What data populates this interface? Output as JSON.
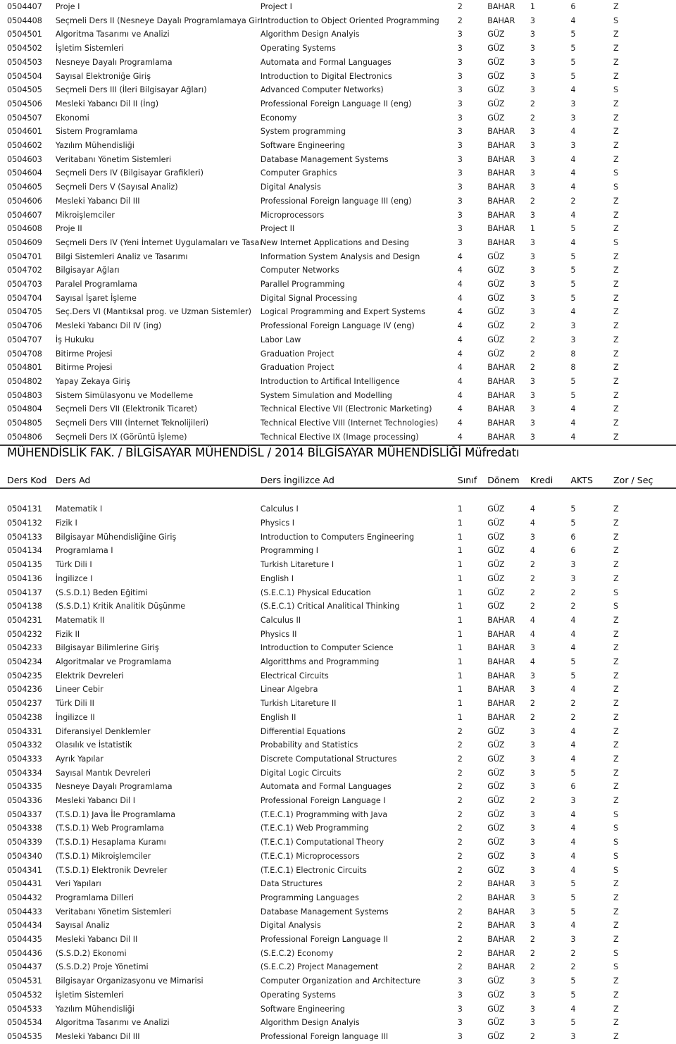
{
  "document": {
    "type": "curriculum-table",
    "columns": [
      "Ders Kod",
      "Ders Ad",
      "Ders İngilizce Ad",
      "Sınıf",
      "Dönem",
      "Kredi",
      "AKTS",
      "Zor / Seç"
    ],
    "section_header": "MÜHENDİSLİK FAK. / BİLGİSAYAR MÜHENDİSL / 2014 BİLGİSAYAR MÜHENDİSLİĞİ Müfredatı"
  },
  "headers": {
    "code": "Ders Kod",
    "name": "Ders Ad",
    "eng_name": "Ders İngilizce Ad",
    "class": "Sınıf",
    "term": "Dönem",
    "credit": "Kredi",
    "akts": "AKTS",
    "type": "Zor / Seç"
  },
  "top_rows": [
    {
      "code": "0504407",
      "name": "Proje I",
      "eng": "Project I",
      "class": "2",
      "term": "BAHAR",
      "credit": "1",
      "akts": "6",
      "type": "Z"
    },
    {
      "code": "0504408",
      "name": "Seçmeli Ders II (Nesneye Dayalı Programlamaya Giri",
      "eng": "Introduction to Object Oriented Programming",
      "class": "2",
      "term": "BAHAR",
      "credit": "3",
      "akts": "4",
      "type": "S"
    },
    {
      "code": "0504501",
      "name": "Algoritma Tasarımı ve Analizi",
      "eng": "Algorithm Design Analyis",
      "class": "3",
      "term": "GÜZ",
      "credit": "3",
      "akts": "5",
      "type": "Z"
    },
    {
      "code": "0504502",
      "name": "İşletim Sistemleri",
      "eng": "Operating Systems",
      "class": "3",
      "term": "GÜZ",
      "credit": "3",
      "akts": "5",
      "type": "Z"
    },
    {
      "code": "0504503",
      "name": "Nesneye Dayalı Programlama",
      "eng": "Automata and Formal Languages",
      "class": "3",
      "term": "GÜZ",
      "credit": "3",
      "akts": "5",
      "type": "Z"
    },
    {
      "code": "0504504",
      "name": "Sayısal Elektroniğe Giriş",
      "eng": "Introduction to Digital Electronics",
      "class": "3",
      "term": "GÜZ",
      "credit": "3",
      "akts": "5",
      "type": "Z"
    },
    {
      "code": "0504505",
      "name": "Seçmeli Ders III (İleri Bilgisayar Ağları)",
      "eng": "Advanced Computer Networks)",
      "class": "3",
      "term": "GÜZ",
      "credit": "3",
      "akts": "4",
      "type": "S"
    },
    {
      "code": "0504506",
      "name": "Mesleki Yabancı Dil II (İng)",
      "eng": "Professional Foreign Language II (eng)",
      "class": "3",
      "term": "GÜZ",
      "credit": "2",
      "akts": "3",
      "type": "Z"
    },
    {
      "code": "0504507",
      "name": "Ekonomi",
      "eng": "Economy",
      "class": "3",
      "term": "GÜZ",
      "credit": "2",
      "akts": "3",
      "type": "Z"
    },
    {
      "code": "0504601",
      "name": "Sistem Programlama",
      "eng": "System programming",
      "class": "3",
      "term": "BAHAR",
      "credit": "3",
      "akts": "4",
      "type": "Z"
    },
    {
      "code": "0504602",
      "name": "Yazılım Mühendisliği",
      "eng": "Software Engineering",
      "class": "3",
      "term": "BAHAR",
      "credit": "3",
      "akts": "3",
      "type": "Z"
    },
    {
      "code": "0504603",
      "name": "Veritabanı Yönetim Sistemleri",
      "eng": "Database Management Systems",
      "class": "3",
      "term": "BAHAR",
      "credit": "3",
      "akts": "4",
      "type": "Z"
    },
    {
      "code": "0504604",
      "name": "Seçmeli Ders IV (Bilgisayar Grafikleri)",
      "eng": "Computer Graphics",
      "class": "3",
      "term": "BAHAR",
      "credit": "3",
      "akts": "4",
      "type": "S"
    },
    {
      "code": "0504605",
      "name": "Seçmeli Ders V (Sayısal Analiz)",
      "eng": "Digital Analysis",
      "class": "3",
      "term": "BAHAR",
      "credit": "3",
      "akts": "4",
      "type": "S"
    },
    {
      "code": "0504606",
      "name": "Mesleki Yabancı Dil III",
      "eng": "Professional Foreign language III (eng)",
      "class": "3",
      "term": "BAHAR",
      "credit": "2",
      "akts": "2",
      "type": "Z"
    },
    {
      "code": "0504607",
      "name": "Mikroişlemciler",
      "eng": "Microprocessors",
      "class": "3",
      "term": "BAHAR",
      "credit": "3",
      "akts": "4",
      "type": "Z"
    },
    {
      "code": "0504608",
      "name": "Proje II",
      "eng": "Project II",
      "class": "3",
      "term": "BAHAR",
      "credit": "1",
      "akts": "5",
      "type": "Z"
    },
    {
      "code": "0504609",
      "name": "Seçmeli Ders IV (Yeni İnternet Uygulamaları ve Tasarım",
      "eng": "New Internet Applications and Desing",
      "class": "3",
      "term": "BAHAR",
      "credit": "3",
      "akts": "4",
      "type": "S"
    },
    {
      "code": "0504701",
      "name": "Bilgi Sistemleri Analiz ve Tasarımı",
      "eng": "Information System Analysis and Design",
      "class": "4",
      "term": "GÜZ",
      "credit": "3",
      "akts": "5",
      "type": "Z"
    },
    {
      "code": "0504702",
      "name": "Bilgisayar Ağları",
      "eng": "Computer Networks",
      "class": "4",
      "term": "GÜZ",
      "credit": "3",
      "akts": "5",
      "type": "Z"
    },
    {
      "code": "0504703",
      "name": "Paralel Programlama",
      "eng": "Parallel Programming",
      "class": "4",
      "term": "GÜZ",
      "credit": "3",
      "akts": "5",
      "type": "Z"
    },
    {
      "code": "0504704",
      "name": "Sayısal İşaret İşleme",
      "eng": "Digital Signal Processing",
      "class": "4",
      "term": "GÜZ",
      "credit": "3",
      "akts": "5",
      "type": "Z"
    },
    {
      "code": "0504705",
      "name": "Seç.Ders VI (Mantıksal prog. ve Uzman Sistemler)",
      "eng": "Logical Programming and Expert Systems",
      "class": "4",
      "term": "GÜZ",
      "credit": "3",
      "akts": "4",
      "type": "Z"
    },
    {
      "code": "0504706",
      "name": "Mesleki Yabancı Dil IV (ing)",
      "eng": "Professional Foreign Language IV (eng)",
      "class": "4",
      "term": "GÜZ",
      "credit": "2",
      "akts": "3",
      "type": "Z"
    },
    {
      "code": "0504707",
      "name": "İş Hukuku",
      "eng": "Labor Law",
      "class": "4",
      "term": "GÜZ",
      "credit": "2",
      "akts": "3",
      "type": "Z"
    },
    {
      "code": "0504708",
      "name": "Bitirme Projesi",
      "eng": "Graduation Project",
      "class": "4",
      "term": "GÜZ",
      "credit": "2",
      "akts": "8",
      "type": "Z"
    },
    {
      "code": "0504801",
      "name": "Bitirme Projesi",
      "eng": "Graduation Project",
      "class": "4",
      "term": "BAHAR",
      "credit": "2",
      "akts": "8",
      "type": "Z"
    },
    {
      "code": "0504802",
      "name": "Yapay Zekaya Giriş",
      "eng": "Introduction to Artifical Intelligence",
      "class": "4",
      "term": "BAHAR",
      "credit": "3",
      "akts": "5",
      "type": "Z"
    },
    {
      "code": "0504803",
      "name": "Sistem Simülasyonu ve Modelleme",
      "eng": "System Simulation and Modelling",
      "class": "4",
      "term": "BAHAR",
      "credit": "3",
      "akts": "5",
      "type": "Z"
    },
    {
      "code": "0504804",
      "name": "Seçmeli Ders VII (Elektronik Ticaret)",
      "eng": "Technical Elective VII (Electronic Marketing)",
      "class": "4",
      "term": "BAHAR",
      "credit": "3",
      "akts": "4",
      "type": "Z"
    },
    {
      "code": "0504805",
      "name": "Seçmeli Ders VIII (İnternet Teknolijileri)",
      "eng": "Technical Elective VIII (Internet Technologies)",
      "class": "4",
      "term": "BAHAR",
      "credit": "3",
      "akts": "4",
      "type": "Z"
    },
    {
      "code": "0504806",
      "name": "Seçmeli Ders IX (Görüntü İşleme)",
      "eng": "Technical Elective IX (Image processing)",
      "class": "4",
      "term": "BAHAR",
      "credit": "3",
      "akts": "4",
      "type": "Z"
    }
  ],
  "bottom_rows": [
    {
      "code": "0504131",
      "name": "Matematik I",
      "eng": "Calculus I",
      "class": "1",
      "term": "GÜZ",
      "credit": "4",
      "akts": "5",
      "type": "Z"
    },
    {
      "code": "0504132",
      "name": "Fizik I",
      "eng": "Physics I",
      "class": "1",
      "term": "GÜZ",
      "credit": "4",
      "akts": "5",
      "type": "Z"
    },
    {
      "code": "0504133",
      "name": "Bilgisayar Mühendisliğine Giriş",
      "eng": "Introduction to Computers Engineering",
      "class": "1",
      "term": "GÜZ",
      "credit": "3",
      "akts": "6",
      "type": "Z"
    },
    {
      "code": "0504134",
      "name": "Programlama I",
      "eng": "Programming I",
      "class": "1",
      "term": "GÜZ",
      "credit": "4",
      "akts": "6",
      "type": "Z"
    },
    {
      "code": "0504135",
      "name": "Türk Dili I",
      "eng": "Turkish Litareture I",
      "class": "1",
      "term": "GÜZ",
      "credit": "2",
      "akts": "3",
      "type": "Z"
    },
    {
      "code": "0504136",
      "name": "İngilizce I",
      "eng": "English I",
      "class": "1",
      "term": "GÜZ",
      "credit": "2",
      "akts": "3",
      "type": "Z"
    },
    {
      "code": "0504137",
      "name": "(S.S.D.1) Beden Eğitimi",
      "eng": "(S.E.C.1) Physical Education",
      "class": "1",
      "term": "GÜZ",
      "credit": "2",
      "akts": "2",
      "type": "S"
    },
    {
      "code": "0504138",
      "name": "(S.S.D.1) Kritik Analitik Düşünme",
      "eng": "(S.E.C.1) Critical Analitical Thinking",
      "class": "1",
      "term": "GÜZ",
      "credit": "2",
      "akts": "2",
      "type": "S"
    },
    {
      "code": "0504231",
      "name": "Matematik II",
      "eng": "Calculus II",
      "class": "1",
      "term": "BAHAR",
      "credit": "4",
      "akts": "4",
      "type": "Z"
    },
    {
      "code": "0504232",
      "name": "Fizik II",
      "eng": "Physics II",
      "class": "1",
      "term": "BAHAR",
      "credit": "4",
      "akts": "4",
      "type": "Z"
    },
    {
      "code": "0504233",
      "name": "Bilgisayar Bilimlerine Giriş",
      "eng": "Introduction to Computer Science",
      "class": "1",
      "term": "BAHAR",
      "credit": "3",
      "akts": "4",
      "type": "Z"
    },
    {
      "code": "0504234",
      "name": "Algoritmalar ve Programlama",
      "eng": "Algoritthms and Programming",
      "class": "1",
      "term": "BAHAR",
      "credit": "4",
      "akts": "5",
      "type": "Z"
    },
    {
      "code": "0504235",
      "name": "Elektrik Devreleri",
      "eng": "Electrical Circuits",
      "class": "1",
      "term": "BAHAR",
      "credit": "3",
      "akts": "5",
      "type": "Z"
    },
    {
      "code": "0504236",
      "name": "Lineer Cebir",
      "eng": "Linear Algebra",
      "class": "1",
      "term": "BAHAR",
      "credit": "3",
      "akts": "4",
      "type": "Z"
    },
    {
      "code": "0504237",
      "name": "Türk Dili II",
      "eng": "Turkish Litareture II",
      "class": "1",
      "term": "BAHAR",
      "credit": "2",
      "akts": "2",
      "type": "Z"
    },
    {
      "code": "0504238",
      "name": "İngilizce II",
      "eng": "English II",
      "class": "1",
      "term": "BAHAR",
      "credit": "2",
      "akts": "2",
      "type": "Z"
    },
    {
      "code": "0504331",
      "name": "Diferansiyel Denklemler",
      "eng": "Differential Equations",
      "class": "2",
      "term": "GÜZ",
      "credit": "3",
      "akts": "4",
      "type": "Z"
    },
    {
      "code": "0504332",
      "name": "Olasılık ve İstatistik",
      "eng": "Probability and Statistics",
      "class": "2",
      "term": "GÜZ",
      "credit": "3",
      "akts": "4",
      "type": "Z"
    },
    {
      "code": "0504333",
      "name": "Ayrık Yapılar",
      "eng": "Discrete Computational Structures",
      "class": "2",
      "term": "GÜZ",
      "credit": "3",
      "akts": "4",
      "type": "Z"
    },
    {
      "code": "0504334",
      "name": "Sayısal Mantık Devreleri",
      "eng": "Digital Logic Circuits",
      "class": "2",
      "term": "GÜZ",
      "credit": "3",
      "akts": "5",
      "type": "Z"
    },
    {
      "code": "0504335",
      "name": "Nesneye Dayalı Programlama",
      "eng": "Automata and Formal Languages",
      "class": "2",
      "term": "GÜZ",
      "credit": "3",
      "akts": "6",
      "type": "Z"
    },
    {
      "code": "0504336",
      "name": "Mesleki Yabancı Dil I",
      "eng": "Professional Foreign Language I",
      "class": "2",
      "term": "GÜZ",
      "credit": "2",
      "akts": "3",
      "type": "Z"
    },
    {
      "code": "0504337",
      "name": "(T.S.D.1) Java İle Programlama",
      "eng": "(T.E.C.1) Programming with Java",
      "class": "2",
      "term": "GÜZ",
      "credit": "3",
      "akts": "4",
      "type": "S"
    },
    {
      "code": "0504338",
      "name": "(T.S.D.1) Web Programlama",
      "eng": "(T.E.C.1) Web Programming",
      "class": "2",
      "term": "GÜZ",
      "credit": "3",
      "akts": "4",
      "type": "S"
    },
    {
      "code": "0504339",
      "name": "(T.S.D.1) Hesaplama Kuramı",
      "eng": "(T.E.C.1) Computational Theory",
      "class": "2",
      "term": "GÜZ",
      "credit": "3",
      "akts": "4",
      "type": "S"
    },
    {
      "code": "0504340",
      "name": "(T.S.D.1) Mikroişlemciler",
      "eng": "(T.E.C.1) Microprocessors",
      "class": "2",
      "term": "GÜZ",
      "credit": "3",
      "akts": "4",
      "type": "S"
    },
    {
      "code": "0504341",
      "name": "(T.S.D.1) Elektronik Devreler",
      "eng": "(T.E.C.1) Electronic Circuits",
      "class": "2",
      "term": "GÜZ",
      "credit": "3",
      "akts": "4",
      "type": "S"
    },
    {
      "code": "0504431",
      "name": "Veri Yapıları",
      "eng": "Data Structures",
      "class": "2",
      "term": "BAHAR",
      "credit": "3",
      "akts": "5",
      "type": "Z"
    },
    {
      "code": "0504432",
      "name": "Programlama Dilleri",
      "eng": "Programming Languages",
      "class": "2",
      "term": "BAHAR",
      "credit": "3",
      "akts": "5",
      "type": "Z"
    },
    {
      "code": "0504433",
      "name": "Veritabanı Yönetim Sistemleri",
      "eng": "Database Management Systems",
      "class": "2",
      "term": "BAHAR",
      "credit": "3",
      "akts": "5",
      "type": "Z"
    },
    {
      "code": "0504434",
      "name": "Sayısal Analiz",
      "eng": "Digital Analysis",
      "class": "2",
      "term": "BAHAR",
      "credit": "3",
      "akts": "4",
      "type": "Z"
    },
    {
      "code": "0504435",
      "name": "Mesleki Yabancı Dil II",
      "eng": "Professional Foreign Language II",
      "class": "2",
      "term": "BAHAR",
      "credit": "2",
      "akts": "3",
      "type": "Z"
    },
    {
      "code": "0504436",
      "name": "(S.S.D.2) Ekonomi",
      "eng": "(S.E.C.2) Economy",
      "class": "2",
      "term": "BAHAR",
      "credit": "2",
      "akts": "2",
      "type": "S"
    },
    {
      "code": "0504437",
      "name": "(S.S.D.2) Proje Yönetimi",
      "eng": "(S.E.C.2) Project Management",
      "class": "2",
      "term": "BAHAR",
      "credit": "2",
      "akts": "2",
      "type": "S"
    },
    {
      "code": "0504531",
      "name": "Bilgisayar Organizasyonu ve Mimarisi",
      "eng": "Computer Organization and Architecture",
      "class": "3",
      "term": "GÜZ",
      "credit": "3",
      "akts": "5",
      "type": "Z"
    },
    {
      "code": "0504532",
      "name": "İşletim Sistemleri",
      "eng": "Operating Systems",
      "class": "3",
      "term": "GÜZ",
      "credit": "3",
      "akts": "5",
      "type": "Z"
    },
    {
      "code": "0504533",
      "name": "Yazılım Mühendisliği",
      "eng": "Software Engineering",
      "class": "3",
      "term": "GÜZ",
      "credit": "3",
      "akts": "4",
      "type": "Z"
    },
    {
      "code": "0504534",
      "name": "Algoritma Tasarımı ve Analizi",
      "eng": "Algorithm Design Analyis",
      "class": "3",
      "term": "GÜZ",
      "credit": "3",
      "akts": "5",
      "type": "Z"
    },
    {
      "code": "0504535",
      "name": "Mesleki Yabancı Dil III",
      "eng": "Professional Foreign language III",
      "class": "3",
      "term": "GÜZ",
      "credit": "2",
      "akts": "3",
      "type": "Z"
    }
  ]
}
